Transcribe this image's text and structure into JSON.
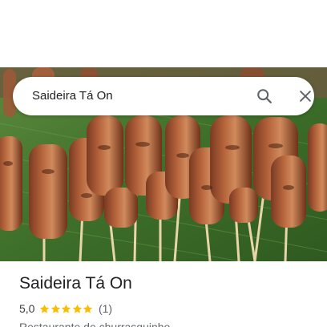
{
  "search": {
    "query": "Saideira Tá On"
  },
  "place": {
    "title": "Saideira Tá On",
    "rating": "5,0",
    "stars": 5,
    "review_count": "(1)",
    "category": "Restaurante de churrasquinho"
  },
  "colors": {
    "star": "#fbbc04",
    "title": "#202124",
    "secondary_text": "#5f6368",
    "leaf": "#3f6d2c"
  },
  "icons": {
    "search": "search-icon",
    "close": "close-icon",
    "star": "star-icon"
  }
}
